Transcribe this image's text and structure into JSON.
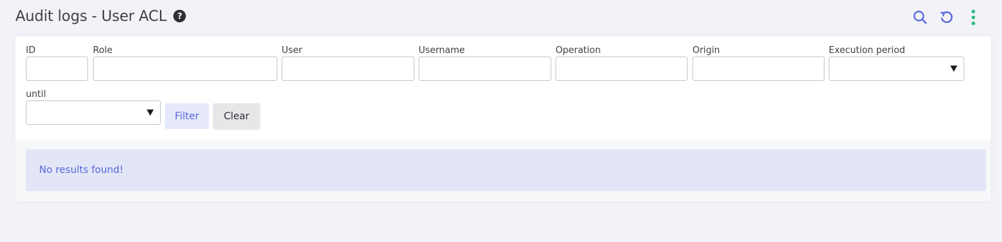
{
  "header": {
    "title": "Audit logs - User ACL",
    "help_icon": "question-circle-icon",
    "help_glyph": "?"
  },
  "toolbar": {
    "search_icon": "search-icon",
    "refresh_icon": "refresh-icon",
    "more_icon": "vertical-dots-icon",
    "colors": {
      "search": "#5867dd",
      "refresh": "#5867dd",
      "more": "#1fb87b"
    }
  },
  "filters": {
    "id": {
      "label": "ID",
      "value": ""
    },
    "role": {
      "label": "Role",
      "value": ""
    },
    "user": {
      "label": "User",
      "value": ""
    },
    "username": {
      "label": "Username",
      "value": ""
    },
    "operation": {
      "label": "Operation",
      "value": ""
    },
    "origin": {
      "label": "Origin",
      "value": ""
    },
    "execution_period": {
      "label": "Execution period",
      "value": ""
    },
    "until": {
      "label": "until",
      "value": ""
    }
  },
  "actions": {
    "filter_label": "Filter",
    "clear_label": "Clear"
  },
  "results": {
    "empty_message": "No results found!"
  },
  "colors": {
    "background": "#f2f3f8",
    "accent": "#5867dd",
    "alert_background": "#e3e6f6",
    "filter_button_background": "#e6e9fb",
    "clear_button_background": "#e7e7e9"
  }
}
